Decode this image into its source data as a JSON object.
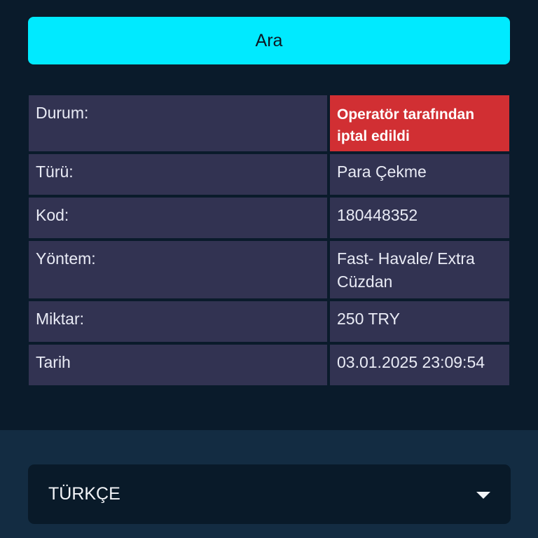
{
  "search": {
    "label": "Ara"
  },
  "details": [
    {
      "label": "Durum:",
      "value": "Operatör tarafından iptal edildi"
    },
    {
      "label": "Türü:",
      "value": "Para Çekme"
    },
    {
      "label": "Kod:",
      "value": "180448352"
    },
    {
      "label": "Yöntem:",
      "value": "Fast- Havale/ Extra Cüzdan"
    },
    {
      "label": "Miktar:",
      "value": "250 TRY"
    },
    {
      "label": "Tarih",
      "value": "03.01.2025 23:09:54"
    }
  ],
  "language": {
    "selected": "TÜRKÇE",
    "icon": "chevron-down-icon"
  },
  "colors": {
    "accent": "#00eaff",
    "status_cancelled": "#d12f33",
    "cell_bg": "#323352",
    "page_bg": "#0a1b2b",
    "footer_bg": "#132c42"
  }
}
